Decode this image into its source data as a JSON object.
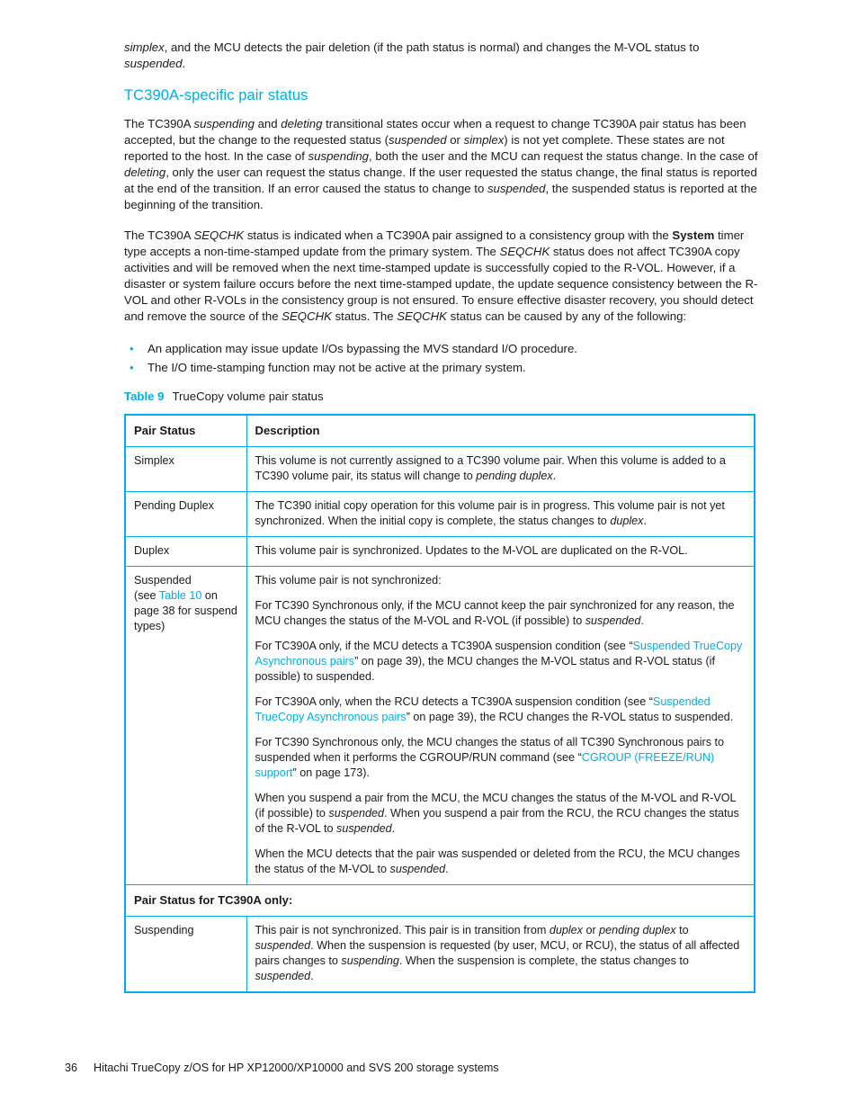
{
  "page": {
    "number": "36",
    "footer_title": "Hitachi TrueCopy z/OS for HP XP12000/XP10000 and SVS 200 storage systems"
  },
  "colors": {
    "accent": "#00ADE8",
    "text": "#1a1a1a",
    "background": "#ffffff",
    "table_border": "#00ADE8"
  },
  "body": {
    "intro_paragraph": "simplex, and the MCU detects the pair deletion (if the path status is normal) and changes the M-VOL status to suspended.",
    "intro_p1_a": "simplex",
    "intro_p1_b": ", and the MCU detects the pair deletion (if the path status is normal) and changes the M-VOL status to ",
    "intro_p1_c": "suspended",
    "intro_p1_d": ".",
    "heading": "TC390A-specific pair status",
    "para1": "The TC390A suspending and deleting transitional states occur when a request to change TC390A pair status has been accepted, but the change to the requested status (suspended or simplex) is not yet complete. These states are not reported to the host. In the case of suspending, both the user and the MCU can request the status change. In the case of deleting, only the user can request the status change. If the user requested the status change, the final status is reported at the end of the transition. If an error caused the status to change to suspended, the suspended status is reported at the beginning of the transition.",
    "para1_parts": {
      "a": "The TC390A ",
      "b": "suspending",
      "c": " and ",
      "d": "deleting",
      "e": " transitional states occur when a request to change TC390A pair status has been accepted, but the change to the requested status (",
      "f": "suspended",
      "g": " or ",
      "h": "simplex",
      "i": ") is not yet complete. These states are not reported to the host. In the case of ",
      "j": "suspending",
      "k": ", both the user and the MCU can request the status change. In the case of ",
      "l": "deleting",
      "m": ", only the user can request the status change. If the user requested the status change, the final status is reported at the end of the transition. If an error caused the status to change to ",
      "n": "suspended",
      "o": ", the suspended status is reported at the beginning of the transition."
    },
    "para2": "The TC390A SEQCHK status is indicated when a TC390A pair assigned to a consistency group with the System timer type accepts a non-time-stamped update from the primary system. The SEQCHK status does not affect TC390A copy activities and will be removed when the next time-stamped update is successfully copied to the R-VOL. However, if a disaster or system failure occurs before the next time-stamped update, the update sequence consistency between the R-VOL and other R-VOLs in the consistency group is not ensured. To ensure effective disaster recovery, you should detect and remove the source of the SEQCHK status. The SEQCHK status can be caused by any of the following:",
    "para2_parts": {
      "a": "The TC390A ",
      "b": "SEQCHK",
      "c": " status is indicated when a TC390A pair assigned to a consistency group with the ",
      "d": "System",
      "e": " timer type accepts a non-time-stamped update from the primary system. The ",
      "f": "SEQCHK",
      "g": " status does not affect TC390A copy activities and will be removed when the next time-stamped update is successfully copied to the R-VOL. However, if a disaster or system failure occurs before the next time-stamped update, the update sequence consistency between the R-VOL and other R-VOLs in the consistency group is not ensured. To ensure effective disaster recovery, you should detect and remove the source of the ",
      "h": "SEQCHK",
      "i": " status. The ",
      "j": "SEQCHK",
      "k": " status can be caused by any of the following:"
    },
    "bullets": [
      "An application may issue update I/Os bypassing the MVS standard I/O procedure.",
      "The I/O time-stamping function may not be active at the primary system."
    ],
    "bullet_glyph": "•"
  },
  "table": {
    "caption_number": "Table 9",
    "caption_text": "TrueCopy volume pair status",
    "headers": [
      "Pair Status",
      "Description"
    ],
    "rows": [
      {
        "status": "Simplex",
        "description": "This volume is not currently assigned to a TC390 volume pair. When this volume is added to a TC390 volume pair, its status will change to pending duplex.",
        "parts": {
          "a": "This volume is not currently assigned to a TC390 volume pair. When this volume is added to a TC390 volume pair, its status will change to ",
          "b": "pending duplex",
          "c": "."
        }
      },
      {
        "status": "Pending Duplex",
        "description": "The TC390 initial copy operation for this volume pair is in progress. This volume pair is not yet synchronized. When the initial copy is complete, the status changes to duplex.",
        "parts": {
          "a": "The TC390 initial copy operation for this volume pair is in progress. This volume pair is not yet synchronized. When the initial copy is complete, the status changes to ",
          "b": "duplex",
          "c": "."
        }
      },
      {
        "status": "Duplex",
        "description": "This volume pair is synchronized. Updates to the M-VOL are duplicated on the R-VOL."
      }
    ],
    "suspended_row": {
      "status_a": "Suspended",
      "status_b": "(see ",
      "status_link": "Table 10",
      "status_c": " on page 38 for suspend types)",
      "p1": "This volume pair is not synchronized:",
      "p2_a": "For TC390 Synchronous only, if the MCU cannot keep the pair synchronized for any reason, the MCU changes the status of the M-VOL and R-VOL (if possible) to ",
      "p2_b": "suspended",
      "p2_c": ".",
      "p3_a": "For TC390A only, if the MCU detects a TC390A suspension condition (see “",
      "p3_link": "Suspended TrueCopy Asynchronous pairs",
      "p3_b": "” on page 39), the MCU changes the M-VOL status and R-VOL status (if possible) to suspended.",
      "p4_a": "For TC390A only, when the RCU detects a TC390A suspension condition (see “",
      "p4_link": "Suspended TrueCopy Asynchronous pairs",
      "p4_b": "” on page 39), the RCU changes the R-VOL status to suspended.",
      "p5_a": "For TC390 Synchronous only, the MCU changes the status of all TC390 Synchronous pairs to suspended when it performs the CGROUP/RUN command (see “",
      "p5_link": "CGROUP (FREEZE/RUN) support",
      "p5_b": "” on page 173).",
      "p6_a": "When you suspend a pair from the MCU, the MCU changes the status of the M-VOL and R-VOL (if possible) to ",
      "p6_b": "suspended",
      "p6_c": ". When you suspend a pair from the RCU, the RCU changes the status of the R-VOL to ",
      "p6_d": "suspended",
      "p6_e": ".",
      "p7_a": "When the MCU detects that the pair was suspended or deleted from the RCU, the MCU changes the status of the M-VOL to ",
      "p7_b": "suspended",
      "p7_c": "."
    },
    "subheading_row": "Pair Status for TC390A only:",
    "suspending_row": {
      "status": "Suspending",
      "p_a": "This pair is not synchronized. This pair is in transition from ",
      "p_b": "duplex",
      "p_c": " or ",
      "p_d": "pending duplex",
      "p_e": " to ",
      "p_f": "suspended",
      "p_g": ". When the suspension is requested (by user, MCU, or RCU), the status of all affected pairs changes to ",
      "p_h": "suspending",
      "p_i": ". When the suspension is complete, the status changes to ",
      "p_j": "suspended",
      "p_k": "."
    }
  }
}
